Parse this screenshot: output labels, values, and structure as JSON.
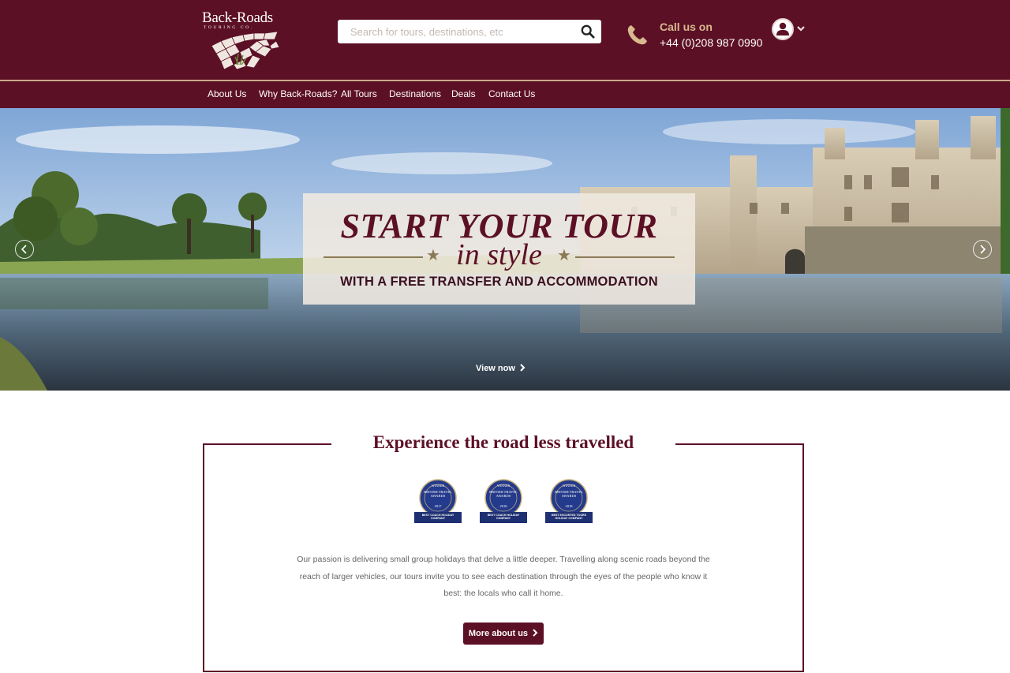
{
  "header": {
    "logo": {
      "name": "Back-Roads",
      "tagline": "TOURING CO."
    },
    "search": {
      "placeholder": "Search for tours, destinations, etc"
    },
    "call": {
      "label": "Call us on",
      "number": "+44 (0)208 987 0990"
    }
  },
  "nav": {
    "items": [
      {
        "label": "About Us"
      },
      {
        "label": "Why Back-Roads?"
      },
      {
        "label": "All Tours"
      },
      {
        "label": "Destinations"
      },
      {
        "label": "Deals"
      },
      {
        "label": "Contact Us"
      }
    ]
  },
  "hero": {
    "line1": "START YOUR TOUR",
    "line2": "in style",
    "line3_prefix": "WITH A ",
    "line3_emphasis": "FREE TRANSFER AND ACCOMMODATION",
    "cta": "View now"
  },
  "intro": {
    "title": "Experience the road less travelled",
    "awards": [
      {
        "top": "WINNER",
        "mid": "BRITISH TRAVEL AWARDS",
        "year": "2017",
        "ribbon": "BEST COACH HOLIDAY COMPANY"
      },
      {
        "top": "WINNER",
        "mid": "BRITISH TRAVEL AWARDS",
        "year": "2018",
        "ribbon": "BEST COACH HOLIDAY COMPANY"
      },
      {
        "top": "WINNER",
        "mid": "BRITISH TRAVEL AWARDS",
        "year": "2018",
        "ribbon": "BEST ESCORTED TOURS HOLIDAY COMPANY"
      }
    ],
    "text": "Our passion is delivering small group holidays that delve a little deeper. Travelling along scenic roads beyond the reach of larger vehicles, our tours invite you to see each destination through the eyes of the people who know it best: the locals who call it home.",
    "button": "More about us"
  },
  "colors": {
    "brand": "#5c1026",
    "gold": "#d9b98e",
    "award_blue": "#243a8c"
  },
  "icons": [
    "search-icon",
    "phone-icon",
    "user-icon",
    "chevron-down-icon",
    "chevron-left-icon",
    "chevron-right-icon",
    "star-icon"
  ]
}
